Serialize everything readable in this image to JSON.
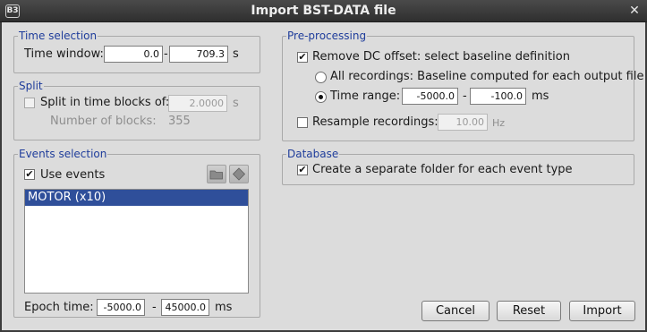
{
  "window": {
    "title": "Import BST-DATA file",
    "app_icon_text": "B3",
    "close_glyph": "✕"
  },
  "time_selection": {
    "title": "Time selection",
    "time_window_label": "Time window:",
    "start": "0.0",
    "separator": "-",
    "end": "709.3",
    "unit": "s"
  },
  "split": {
    "title": "Split",
    "split_label": "Split in time blocks of:",
    "split_checked": false,
    "block_size": "2.0000",
    "block_unit": "s",
    "num_blocks_label": "Number of blocks:",
    "num_blocks_value": "355"
  },
  "events_selection": {
    "title": "Events selection",
    "use_events_label": "Use events",
    "use_events_checked": true,
    "events": [
      {
        "label": "MOTOR (x10)",
        "selected": true
      }
    ],
    "epoch_label": "Epoch time:",
    "epoch_start": "-5000.0",
    "separator": "-",
    "epoch_end": "45000.0",
    "epoch_unit": "ms"
  },
  "preprocessing": {
    "title": "Pre-processing",
    "remove_dc_label": "Remove DC offset: select baseline definition",
    "remove_dc_checked": true,
    "all_recordings_label": "All recordings: Baseline computed for each output file",
    "time_range_label": "Time range:",
    "time_range_selected": true,
    "range_start": "-5000.0",
    "separator": "-",
    "range_end": "-100.0",
    "range_unit": "ms",
    "resample_label": "Resample recordings:",
    "resample_checked": false,
    "resample_value": "10.00",
    "resample_unit": "Hz"
  },
  "database": {
    "title": "Database",
    "separate_folder_label": "Create a separate folder for each event type",
    "separate_folder_checked": true
  },
  "buttons": {
    "cancel": "Cancel",
    "reset": "Reset",
    "import": "Import"
  },
  "glyphs": {
    "check": "✔"
  },
  "icons": [
    "folder-icon",
    "diamond-icon"
  ]
}
